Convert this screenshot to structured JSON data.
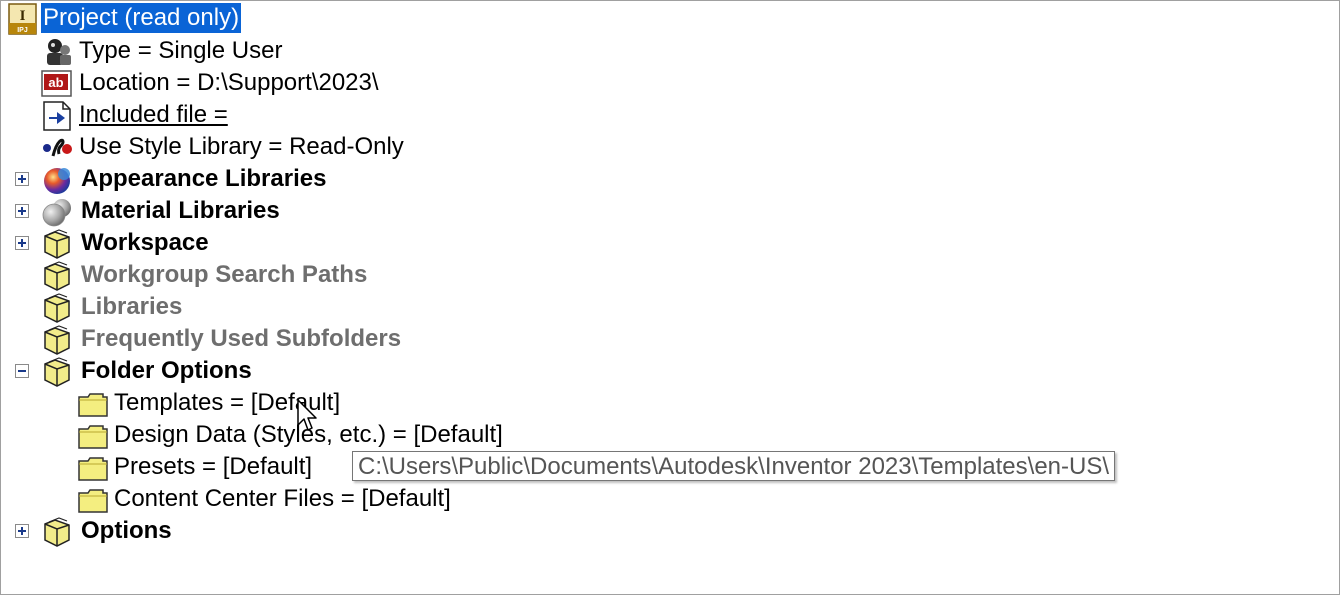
{
  "project": {
    "label": "Project (read only)",
    "badge": "IPJ"
  },
  "properties": [
    {
      "label": "Type = Single User"
    },
    {
      "label": "Location = D:\\Support\\2023\\"
    },
    {
      "label": "Included file = "
    },
    {
      "label": "Use Style Library = Read-Only"
    }
  ],
  "groups": {
    "appearance": "Appearance Libraries",
    "material": "Material Libraries",
    "workspace": "Workspace",
    "workgroup": "Workgroup Search Paths",
    "libraries": "Libraries",
    "frequent": "Frequently Used Subfolders",
    "folder_options": "Folder Options",
    "options": "Options"
  },
  "folder_options": [
    {
      "label": "Templates = [Default]"
    },
    {
      "label": "Design Data (Styles, etc.) = [Default]"
    },
    {
      "label": "Presets = [Default]"
    },
    {
      "label": "Content Center Files = [Default]"
    }
  ],
  "tooltip": "C:\\Users\\Public\\Documents\\Autodesk\\Inventor 2023\\Templates\\en-US\\"
}
